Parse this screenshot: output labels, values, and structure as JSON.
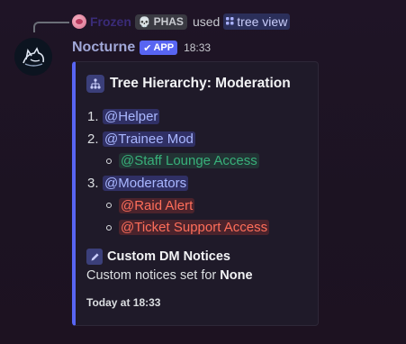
{
  "reply": {
    "author": "Frozen",
    "tag": "PHAS",
    "used_text": "used",
    "command": "tree view"
  },
  "message": {
    "author": "Nocturne",
    "app_badge": "APP",
    "time": "18:33"
  },
  "embed": {
    "accent_color": "#5865f2",
    "title": "Tree Hierarchy: Moderation",
    "tree": [
      {
        "number": "1.",
        "role": "@Helper",
        "color": "blue",
        "children": []
      },
      {
        "number": "2.",
        "role": "@Trainee Mod",
        "color": "blue",
        "children": [
          {
            "role": "@Staff Lounge Access",
            "color": "green"
          }
        ]
      },
      {
        "number": "3.",
        "role": "@Moderators",
        "color": "blue",
        "children": [
          {
            "role": "@Raid Alert",
            "color": "red"
          },
          {
            "role": "@Ticket Support Access",
            "color": "red"
          }
        ]
      }
    ],
    "field": {
      "name": "Custom DM Notices",
      "value_prefix": "Custom notices set for",
      "value_bold": "None"
    },
    "footer": "Today at 18:33"
  },
  "icons": {
    "reply_avatar": "avatar-icon",
    "tag_icon": "skull-icon",
    "command_icon": "grid-icon",
    "app_check": "checkmark-icon",
    "title_emoji": "hierarchy-icon",
    "field_emoji": "pencil-icon"
  }
}
